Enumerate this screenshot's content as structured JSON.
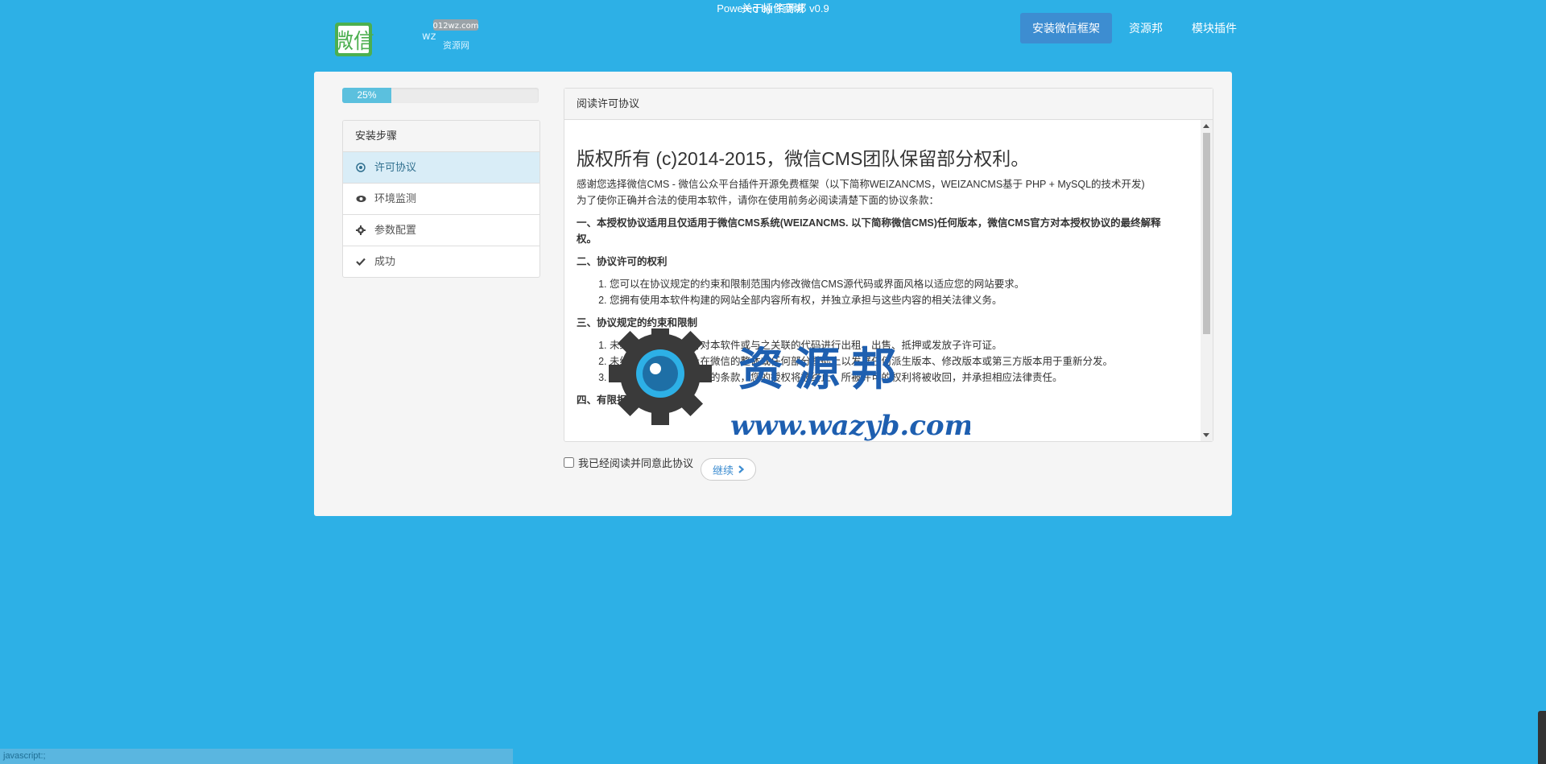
{
  "header": {
    "logo_text": "微信",
    "logo_badge": "012wz.com",
    "logo_sub": "wz",
    "logo_sub2": "资源网",
    "nav": [
      {
        "label": "安装微信框架",
        "active": true
      },
      {
        "label": "资源邦",
        "active": false
      },
      {
        "label": "模块插件",
        "active": false
      }
    ]
  },
  "progress": {
    "label": "25%",
    "value": 25
  },
  "steps": {
    "title": "安装步骤",
    "items": [
      {
        "label": "许可协议",
        "icon": "circle-check-icon",
        "active": true
      },
      {
        "label": "环境监测",
        "icon": "eye-icon",
        "active": false
      },
      {
        "label": "参数配置",
        "icon": "gear-icon",
        "active": false
      },
      {
        "label": "成功",
        "icon": "check-icon",
        "active": false
      }
    ]
  },
  "license": {
    "panel_title": "阅读许可协议",
    "heading": "版权所有 (c)2014-2015，微信CMS团队保留部分权利。",
    "intro1": "感谢您选择微信CMS - 微信公众平台插件开源免费框架（以下简称WEIZANCMS，WEIZANCMS基于 PHP + MySQL的技术开发)",
    "intro2": "为了使你正确并合法的使用本软件，请你在使用前务必阅读清楚下面的协议条款：",
    "section1": "一、本授权协议适用且仅适用于微信CMS系统(WEIZANCMS. 以下简称微信CMS)任何版本，微信CMS官方对本授权协议的最终解释权。",
    "section2": "二、协议许可的权利",
    "section2_items": [
      "您可以在协议规定的约束和限制范围内修改微信CMS源代码或界面风格以适应您的网站要求。",
      "您拥有使用本软件构建的网站全部内容所有权，并独立承担与这些内容的相关法律义务。"
    ],
    "section3": "三、协议规定的约束和限制",
    "section3_items": [
      "未经官方许可，不得对本软件或与之关联的代码进行出租、出售、抵押或发放子许可证。",
      "未经官方许可，禁止在微信的整体或任何部分基础上以发展任何派生版本、修改版本或第三方版本用于重新分发。",
      "如果您未能遵守本协议的条款，您的授权将被终止，所被许可的权利将被收回，并承担相应法律责任。"
    ],
    "section4": "四、有限担保和免责声明"
  },
  "agree_label": "我已经阅读并同意此协议",
  "continue_label": "继续",
  "watermark": {
    "title": "资源邦",
    "url": "www.wazyb.com"
  },
  "footer": {
    "link": "关于插件商城",
    "powered": "Powered by 资源邦 v0.9"
  },
  "statusbar": "javascript:;",
  "colors": {
    "background": "#2db0e6",
    "nav_active": "#3d8dd1",
    "progress": "#5bc0de",
    "step_active": "#d9edf7"
  }
}
